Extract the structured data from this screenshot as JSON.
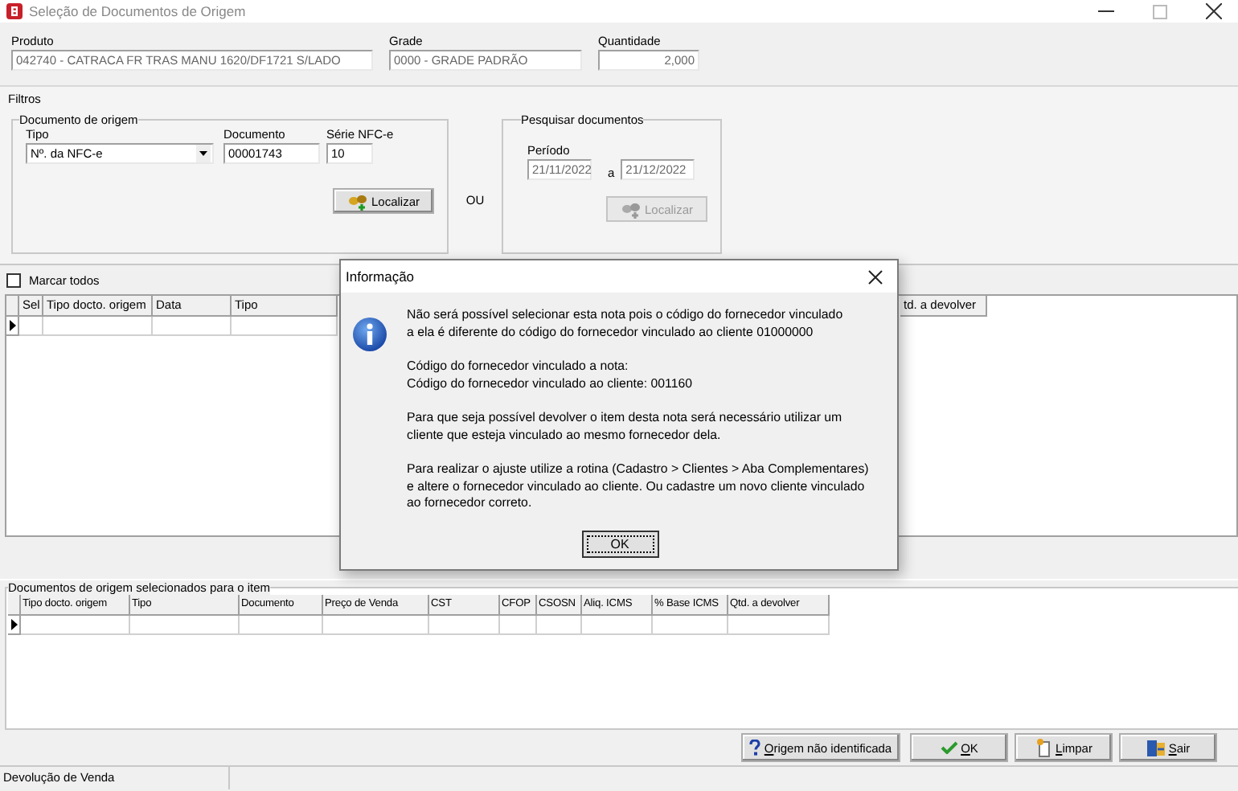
{
  "window": {
    "title": "Seleção de Documentos de Origem"
  },
  "header_fields": [
    {
      "label": "Produto",
      "value": "042740 - CATRACA FR TRAS MANU 1620/DF1721 S/LADO"
    },
    {
      "label": "Grade",
      "value": "0000 - GRADE PADRÃO"
    },
    {
      "label": "Quantidade",
      "value": "2,000"
    }
  ],
  "filters": {
    "title": "Filtros",
    "origin_group": {
      "title": "Documento de origem",
      "type_label": "Tipo",
      "type_value": "Nº. da NFC-e",
      "document_label": "Documento",
      "document_value": "00001743",
      "series_label": "Série NFC-e",
      "series_value": "10",
      "search_button": {
        "label": "Localizar",
        "disabled": false
      }
    },
    "or_label": "OU",
    "search_group": {
      "title": "Pesquisar documentos",
      "period_label": "Período",
      "date_from": "21/11/2022",
      "separator": "a",
      "date_to": "21/12/2022",
      "search_button": {
        "label": "Localizar",
        "disabled": true
      }
    }
  },
  "select_all": {
    "label": "Marcar todos",
    "checked": false
  },
  "documents_table": {
    "columns": [
      "Sel",
      "Tipo docto. origem",
      "Data",
      "Tipo",
      "td. a devolver"
    ]
  },
  "selected_group": {
    "title": "Documentos de origem selecionados para o item",
    "columns": [
      "Tipo docto. origem",
      "Tipo",
      "Documento",
      "Preço de Venda",
      "CST",
      "CFOP",
      "CSOSN",
      "Aliq. ICMS",
      "% Base ICMS",
      "Qtd. a devolver"
    ]
  },
  "buttons": [
    {
      "kind": "help",
      "label": "Origem não identificada"
    },
    {
      "kind": "ok",
      "label": "OK"
    },
    {
      "kind": "clear",
      "label": "Limpar"
    },
    {
      "kind": "exit",
      "label": "Sair"
    }
  ],
  "status_bar": {
    "text": "Devolução de Venda"
  },
  "dialog": {
    "title": "Informação",
    "paragraphs": [
      [
        "Não será possível selecionar esta nota pois o código do fornecedor vinculado",
        "a ela é diferente do código do fornecedor vinculado ao cliente 01000000"
      ],
      [
        "Código do fornecedor vinculado a nota:",
        "Código do fornecedor vinculado ao cliente: 001160"
      ],
      [
        "Para que seja possível devolver o item desta nota será necessário utilizar um",
        "cliente que esteja vinculado ao mesmo fornecedor dela."
      ],
      [
        "Para realizar o ajuste utilize a rotina (Cadastro > Clientes > Aba Complementares)",
        "e altere o fornecedor vinculado ao cliente. Ou cadastre um novo cliente vinculado",
        "ao fornecedor correto."
      ]
    ],
    "button": "OK"
  }
}
